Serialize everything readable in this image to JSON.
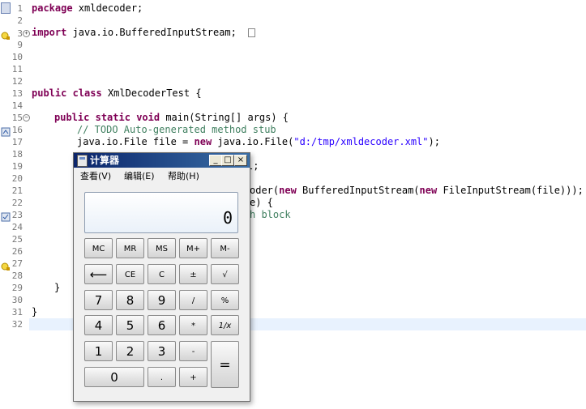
{
  "editor": {
    "line_numbers": [
      "1",
      "2",
      "3",
      "9",
      "10",
      "11",
      "12",
      "13",
      "14",
      "15",
      "16",
      "17",
      "18",
      "19",
      "20",
      "21",
      "22",
      "23",
      "24",
      "25",
      "26",
      "27",
      "28",
      "29",
      "30",
      "31",
      "32"
    ],
    "lines": {
      "l1_kw": "package",
      "l1_rest": " xmldecoder;",
      "l3_kw": "import",
      "l3_rest": " java.io.BufferedInputStream;",
      "l13_kw1": "public",
      "l13_kw2": "class",
      "l13_rest": " XmlDecoderTest {",
      "l15_kw1": "public",
      "l15_kw2": "static",
      "l15_kw3": "void",
      "l15_rest": " main(String[] args) {",
      "l16_comment": "// TODO Auto-generated method stub",
      "l17_a": "java.io.File file = ",
      "l17_kw": "new",
      "l17_b": " java.io.File(",
      "l17_str": "\"d:/tmp/xmldecoder.xml\"",
      "l17_c": ");",
      "l19_tail": "l;",
      "l21_a": "oder(",
      "l21_kw1": "new",
      "l21_b": " BufferedInputStream(",
      "l21_kw2": "new",
      "l21_c": " FileInputStream(file)));",
      "l22_tail": "e) {",
      "l23_tail": "h block",
      "l30": "}",
      "l31": "}"
    }
  },
  "calculator": {
    "title": "计算器",
    "menu": [
      "查看(V)",
      "编辑(E)",
      "帮助(H)"
    ],
    "display_value": "0",
    "window_buttons": {
      "minimize": "_",
      "maximize": "□",
      "close": "×"
    },
    "keys": {
      "mc": "MC",
      "mr": "MR",
      "ms": "MS",
      "mplus": "M+",
      "mminus": "M-",
      "back": "⟵",
      "ce": "CE",
      "c": "C",
      "plusminus": "±",
      "sqrt": "√",
      "k7": "7",
      "k8": "8",
      "k9": "9",
      "div": "/",
      "pct": "%",
      "k4": "4",
      "k5": "5",
      "k6": "6",
      "mul": "*",
      "recip": "1/x",
      "k1": "1",
      "k2": "2",
      "k3": "3",
      "sub": "-",
      "eq": "=",
      "k0": "0",
      "dot": ".",
      "add": "+"
    }
  },
  "colors": {
    "keyword": "#7f0055",
    "comment": "#3f7f5f",
    "string": "#2a00ff",
    "titlebar": "#0a246a"
  }
}
